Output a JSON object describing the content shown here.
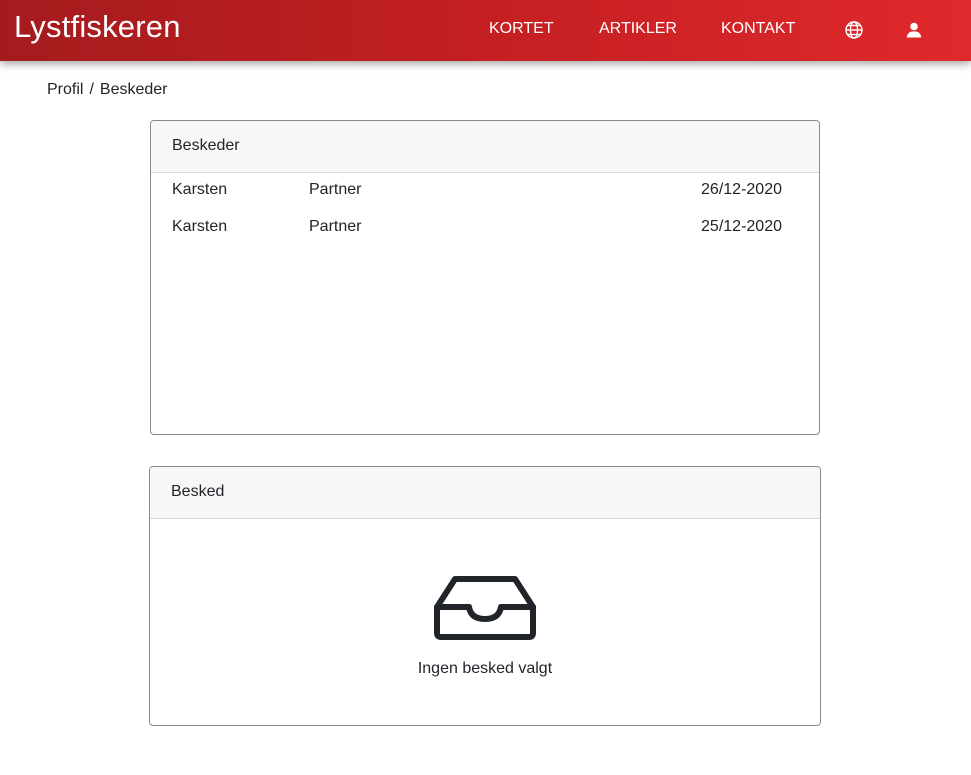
{
  "header": {
    "brand": "Lystfiskeren",
    "nav": [
      {
        "label": "KORTET"
      },
      {
        "label": "ARTIKLER"
      },
      {
        "label": "KONTAKT"
      }
    ],
    "icons": [
      "globe-icon",
      "user-icon"
    ],
    "gradient": [
      "#a41b1e",
      "#e0292c"
    ]
  },
  "breadcrumb": {
    "items": [
      "Profil",
      "Beskeder"
    ],
    "separator": "/"
  },
  "messages_card": {
    "title": "Beskeder",
    "rows": [
      {
        "sender": "Karsten",
        "subject": "Partner",
        "date": "26/12-2020"
      },
      {
        "sender": "Karsten",
        "subject": "Partner",
        "date": "25/12-2020"
      }
    ]
  },
  "message_card": {
    "title": "Besked",
    "empty_icon": "inbox-icon",
    "empty_text": "Ingen besked valgt"
  }
}
